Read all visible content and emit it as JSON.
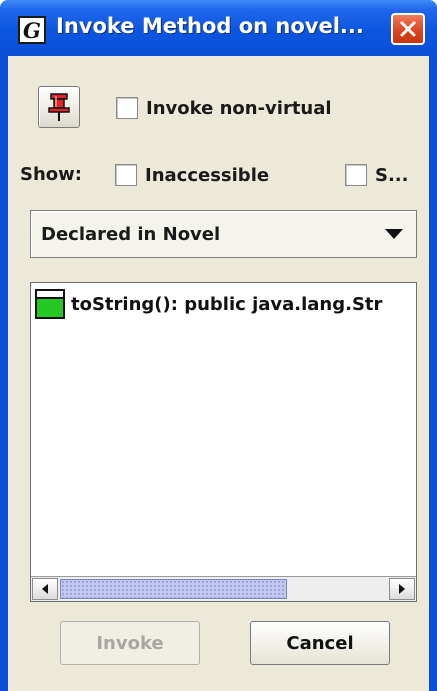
{
  "window": {
    "title": "Invoke Method on novel...",
    "app_icon_letter": "G",
    "icons": {
      "app": "greenfoot-app-icon",
      "close": "close-icon"
    }
  },
  "toolbar": {
    "pin_icon": "pushpin-icon",
    "invoke_non_virtual_label": "Invoke non-virtual",
    "invoke_non_virtual_checked": false
  },
  "show_row": {
    "label": "Show:",
    "inaccessible_label": "Inaccessible",
    "inaccessible_checked": false,
    "truncated_label": "S...",
    "truncated_checked": false
  },
  "dropdown": {
    "selected": "Declared in Novel",
    "icon": "chevron-down-icon"
  },
  "methods": [
    {
      "icon": "method-icon",
      "signature": "toString():  public java.lang.Str"
    }
  ],
  "scrollbar": {
    "thumb_fraction": 0.69
  },
  "buttons": {
    "invoke_label": "Invoke",
    "invoke_enabled": false,
    "cancel_label": "Cancel"
  },
  "colors": {
    "title_bar": "#0a4fd6",
    "close_button": "#d8431d",
    "method_icon_green": "#24c824",
    "panel_background": "#ece9d8",
    "scroll_thumb": "#c3c9ee"
  }
}
